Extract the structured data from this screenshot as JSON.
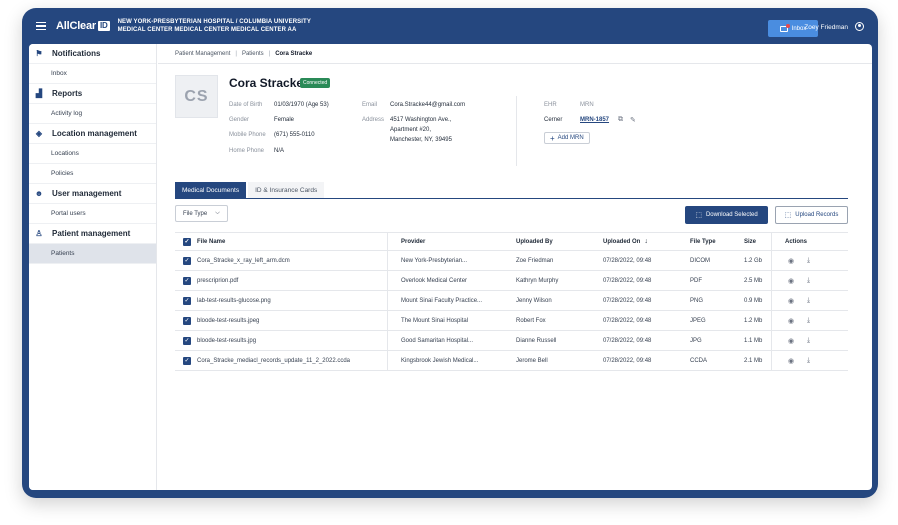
{
  "topbar": {
    "logo_text": "AllClear",
    "logo_badge": "ID",
    "org_line1": "NEW YORK-PRESBYTERIAN HOSPITAL / COLUMBIA UNIVERSITY",
    "org_line2": "MEDICAL CENTER MEDICAL CENTER MEDICAL CENTER AA",
    "inbox_label": "Inbox",
    "user_name": "Zoey Friedman"
  },
  "sidebar": {
    "sections": [
      {
        "label": "Notifications",
        "icon": "flag-icon",
        "items": [
          "Inbox"
        ]
      },
      {
        "label": "Reports",
        "icon": "chart-icon",
        "items": [
          "Activity log"
        ]
      },
      {
        "label": "Location management",
        "icon": "layers-icon",
        "items": [
          "Locations",
          "Policies"
        ]
      },
      {
        "label": "User management",
        "icon": "users-icon",
        "items": [
          "Portal users"
        ]
      },
      {
        "label": "Patient management",
        "icon": "patient-icon",
        "items": [
          "Patients"
        ]
      }
    ],
    "active_item": "Patients"
  },
  "breadcrumb": [
    "Patient Management",
    "Patients",
    "Cora Stracke"
  ],
  "patient": {
    "initials": "CS",
    "name": "Cora Stracke",
    "status": "Connected",
    "dob_label": "Date of Birth",
    "dob": "01/03/1970 (Age 53)",
    "gender_label": "Gender",
    "gender": "Female",
    "mobile_label": "Mobile Phone",
    "mobile": "(671) 555-0110",
    "home_label": "Home Phone",
    "home": "N/A",
    "email_label": "Email",
    "email": "Cora.Stracke44@gmail.com",
    "address_label": "Address",
    "address1": "4517 Washington Ave.,",
    "address2": "Apartment #20,",
    "address3": "Manchester, NY, 39495",
    "ehr_label": "EHR",
    "mrn_label": "MRN",
    "ehr": "Cerner",
    "mrn": "MRN-1857",
    "add_mrn": "Add MRN"
  },
  "tabs": [
    "Medical Documents",
    "ID & Insurance Cards"
  ],
  "filter": {
    "file_type": "File Type"
  },
  "actions": {
    "download": "Download Selected",
    "upload": "Upload Records"
  },
  "table": {
    "columns": [
      "File Name",
      "Provider",
      "Uploaded By",
      "Uploaded On",
      "File Type",
      "Size",
      "Actions"
    ],
    "rows": [
      {
        "name": "Cora_Stracke_x_ray_left_arm.dcm",
        "provider": "New York-Presbyterian...",
        "by": "Zoe Friedman",
        "on": "07/28/2022, 09:48",
        "type": "DICOM",
        "size": "1.2 Gb"
      },
      {
        "name": "prescriprion.pdf",
        "provider": "Overlook Medical Center",
        "by": "Kathryn Murphy",
        "on": "07/28/2022, 09:48",
        "type": "PDF",
        "size": "2.5 Mb"
      },
      {
        "name": "lab-test-results-glucose.png",
        "provider": "Mount Sinai Faculty Practice...",
        "by": "Jenny Wilson",
        "on": "07/28/2022, 09:48",
        "type": "PNG",
        "size": "0.9 Mb"
      },
      {
        "name": "bloode-test-results.jpeg",
        "provider": "The Mount Sinai Hospital",
        "by": "Robert Fox",
        "on": "07/28/2022, 09:48",
        "type": "JPEG",
        "size": "1.2 Mb"
      },
      {
        "name": "bloode-test-results.jpg",
        "provider": "Good Samaritan Hospital...",
        "by": "Dianne Russell",
        "on": "07/28/2022, 09:48",
        "type": "JPG",
        "size": "1.1 Mb"
      },
      {
        "name": "Cora_Stracke_mediacl_records_update_11_2_2022.ccda",
        "provider": "Kingsbrook Jewish Medical...",
        "by": "Jerome Bell",
        "on": "07/28/2022, 09:48",
        "type": "CCDA",
        "size": "2.1 Mb"
      }
    ]
  }
}
